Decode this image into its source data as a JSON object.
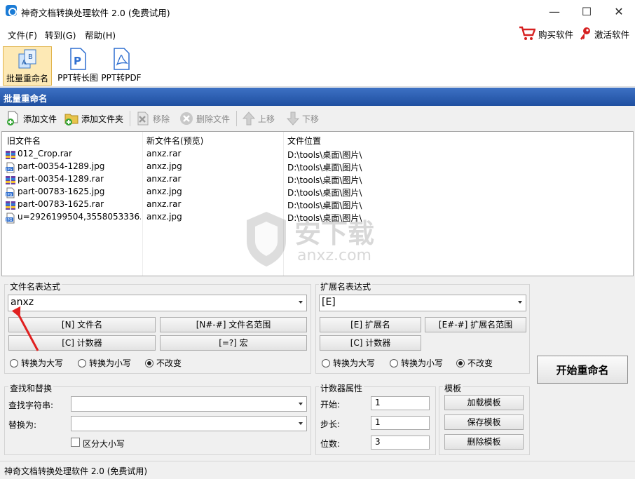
{
  "window": {
    "title": "神奇文档转换处理软件 2.0 (免费试用)",
    "minimize": "—",
    "maximize": "☐",
    "close": "✕"
  },
  "menu": {
    "file": "文件(F)",
    "goto": "转到(G)",
    "help": "帮助(H)",
    "buy": "购买软件",
    "activate": "激活软件"
  },
  "toolbar": {
    "batch_rename": "批量重命名",
    "ppt_long": "PPT转长图",
    "ppt_pdf": "PPT转PDF"
  },
  "section": {
    "title": "批量重命名"
  },
  "actions": {
    "add_file": "添加文件",
    "add_folder": "添加文件夹",
    "remove": "移除",
    "delete_file": "删除文件",
    "move_up": "上移",
    "move_down": "下移"
  },
  "filelist": {
    "headers": [
      "旧文件名",
      "新文件名(预览)",
      "文件位置"
    ],
    "rows": [
      {
        "icon": "rar-icon",
        "old": "012_Crop.rar",
        "new": "anxz.rar",
        "path": "D:\\tools\\桌面\\图片\\"
      },
      {
        "icon": "jpg-icon",
        "old": "part-00354-1289.jpg",
        "new": "anxz.jpg",
        "path": "D:\\tools\\桌面\\图片\\"
      },
      {
        "icon": "rar-icon",
        "old": "part-00354-1289.rar",
        "new": "anxz.rar",
        "path": "D:\\tools\\桌面\\图片\\"
      },
      {
        "icon": "jpg-icon",
        "old": "part-00783-1625.jpg",
        "new": "anxz.jpg",
        "path": "D:\\tools\\桌面\\图片\\"
      },
      {
        "icon": "rar-icon",
        "old": "part-00783-1625.rar",
        "new": "anxz.rar",
        "path": "D:\\tools\\桌面\\图片\\"
      },
      {
        "icon": "jpg-icon",
        "old": "u=2926199504,3558053336...",
        "new": "anxz.jpg",
        "path": "D:\\tools\\桌面\\图片\\"
      }
    ]
  },
  "filename_expr": {
    "label": "文件名表达式",
    "value": "anxz",
    "btn_name": "[N] 文件名",
    "btn_range": "[N#-#] 文件名范围",
    "btn_counter": "[C] 计数器",
    "btn_macro": "[=?] 宏",
    "radio_upper": "转换为大写",
    "radio_lower": "转换为小写",
    "radio_keep": "不改变"
  },
  "ext_expr": {
    "label": "扩展名表达式",
    "value": "[E]",
    "btn_ext": "[E] 扩展名",
    "btn_range": "[E#-#] 扩展名范围",
    "btn_counter": "[C] 计数器",
    "radio_upper": "转换为大写",
    "radio_lower": "转换为小写",
    "radio_keep": "不改变"
  },
  "start": {
    "label": "开始重命名"
  },
  "find_replace": {
    "label": "查找和替换",
    "find_label": "查找字符串:",
    "replace_label": "替换为:",
    "case_label": "区分大小写"
  },
  "counter": {
    "label": "计数器属性",
    "start_label": "开始:",
    "start_value": "1",
    "step_label": "步长:",
    "step_value": "1",
    "digits_label": "位数:",
    "digits_value": "3"
  },
  "template": {
    "label": "模板",
    "load": "加载模板",
    "save": "保存模板",
    "delete": "删除模板"
  },
  "status": {
    "text": "神奇文档转换处理软件 2.0 (免费试用)"
  },
  "watermark": {
    "text": "安下载",
    "sub": "anxz.com"
  },
  "colors": {
    "header_blue": "#2a5db0",
    "accent_red": "#e02020"
  }
}
